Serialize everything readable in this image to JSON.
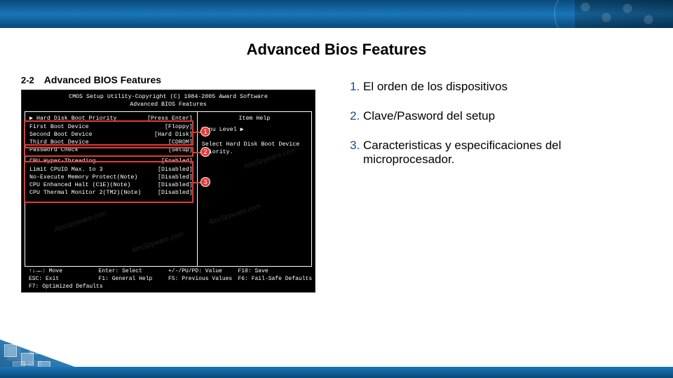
{
  "slide": {
    "title": "Advanced Bios Features"
  },
  "bios": {
    "section_no": "2-2",
    "section_title": "Advanced BIOS Features",
    "top_line1": "CMOS Setup Utility-Copyright (C) 1984-2005 Award Software",
    "top_line2": "Advanced BIOS Features",
    "help_title": "Item Help",
    "help_sub": "Menu Level ▶",
    "help_text": "Select Hard Disk Boot Device Priority.",
    "rows": {
      "r0k": "▶ Hard Disk Boot Priority",
      "r0v": "[Press Enter]",
      "r1k": "  First Boot Device",
      "r1v": "[Floppy]",
      "r2k": "  Second Boot Device",
      "r2v": "[Hard Disk]",
      "r3k": "  Third Boot Device",
      "r3v": "[CDROM]",
      "r4k": "  Password Check",
      "r4v": "[Setup]",
      "r5k": "  CPU Hyper-Threading",
      "r5v": "[Enabled]",
      "r6k": "  Limit CPUID Max. to 3",
      "r6v": "[Disabled]",
      "r7k": "  No-Execute Memory Protect(Note)",
      "r7v": "[Disabled]",
      "r8k": "  CPU Enhanced Halt (C1E)(Note)",
      "r8v": "[Disabled]",
      "r9k": "  CPU Thermal Monitor 2(TM2)(Note)",
      "r9v": "[Disabled]"
    },
    "footer": {
      "f0": "↑↓→←: Move",
      "f1": "Enter: Select",
      "f2": "+/-/PU/PD: Value",
      "f3": "F10: Save",
      "f4": "ESC: Exit",
      "f5": "F1: General Help",
      "f6": "F5: Previous Values",
      "f7": "F6: Fail-Safe Defaults",
      "f8": "F7: Optimized Defaults"
    },
    "badges": {
      "b1": "1",
      "b2": "2",
      "b3": "3"
    }
  },
  "notes": {
    "n1": "El orden de los dispositivos",
    "n2": "Clave/Pasword del setup",
    "n3": "Caracteristicas y especificaciones del microprocesador."
  }
}
